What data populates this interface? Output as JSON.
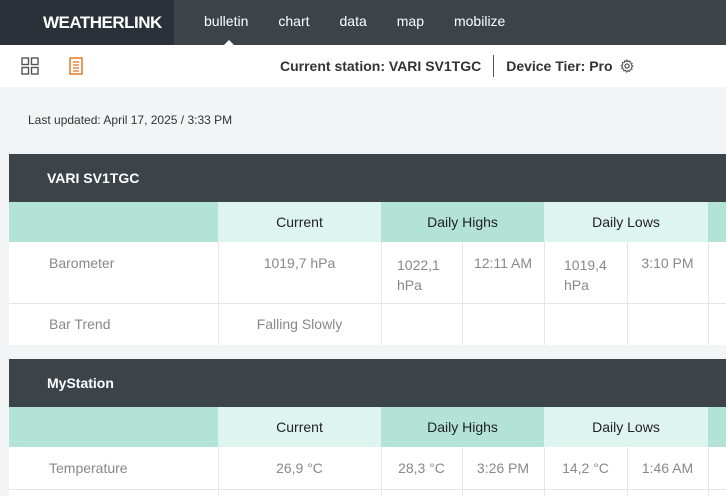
{
  "app": {
    "logo": "WEATHERLINK"
  },
  "nav": {
    "items": [
      "bulletin",
      "chart",
      "data",
      "map",
      "mobilize"
    ],
    "active": "bulletin"
  },
  "toolbar": {
    "station_label": "Current station: VARI SV1TGC",
    "tier_label": "Device Tier: Pro"
  },
  "last_updated": "Last updated: April 17, 2025 / 3:33 PM",
  "columns": {
    "current": "Current",
    "highs": "Daily Highs",
    "lows": "Daily Lows"
  },
  "sections": [
    {
      "title": "VARI SV1TGC",
      "rows": [
        {
          "label": "Barometer",
          "current": "1019,7 hPa",
          "high_val": "1022,1 hPa",
          "high_time": "12:11 AM",
          "low_val": "1019,4 hPa",
          "low_time": "3:10 PM"
        },
        {
          "label": "Bar Trend",
          "current": "Falling Slowly",
          "high_val": "",
          "high_time": "",
          "low_val": "",
          "low_time": ""
        }
      ]
    },
    {
      "title": "MyStation",
      "rows": [
        {
          "label": "Temperature",
          "current": "26,9 °C",
          "high_val": "28,3 °C",
          "high_time": "3:26 PM",
          "low_val": "14,2 °C",
          "low_time": "1:46 AM"
        }
      ]
    }
  ],
  "colors": {
    "topbar": "#3c4349",
    "logo_bg": "#2a3138",
    "header_light": "#def4ee",
    "header_mid": "#b3e3d6",
    "accent_orange": "#e87722"
  }
}
